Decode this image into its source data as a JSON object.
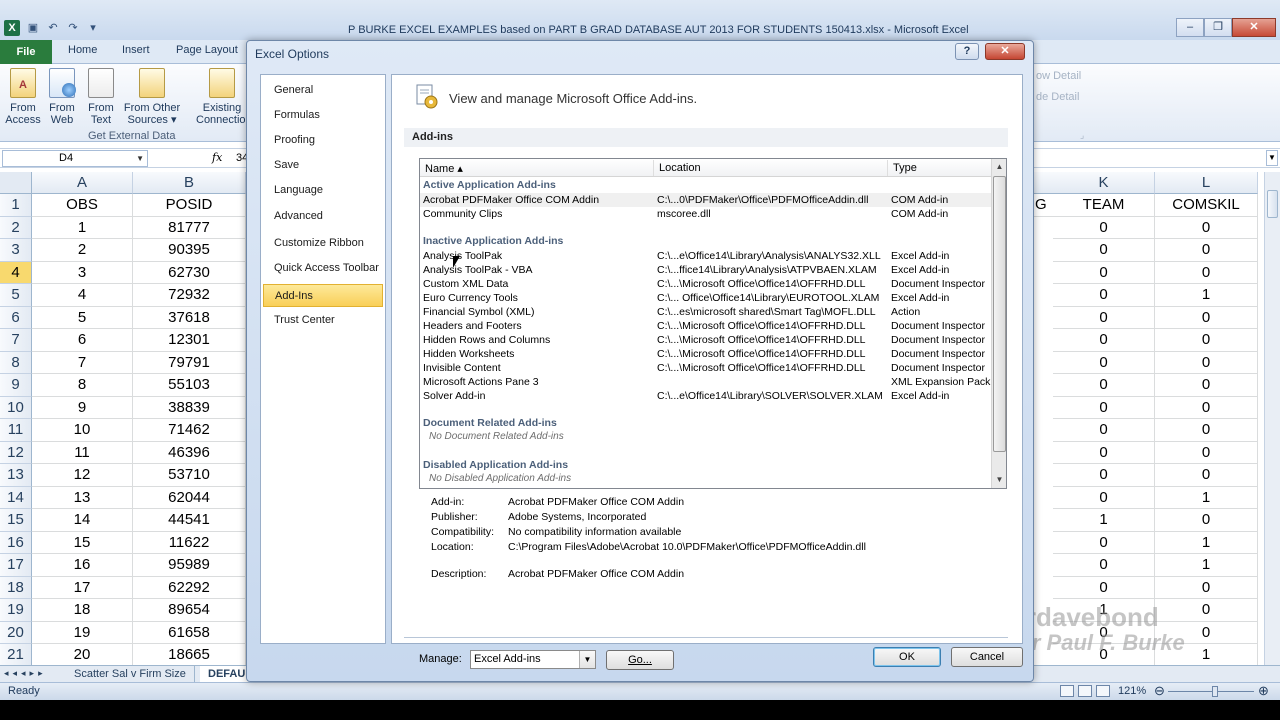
{
  "window": {
    "title": "P BURKE EXCEL EXAMPLES based on PART B GRAD DATABASE AUT 2013 FOR STUDENTS 150413.xlsx  -  Microsoft Excel"
  },
  "ribbon_tabs": [
    "File",
    "Home",
    "Insert",
    "Page Layout"
  ],
  "ribbon": {
    "buttons": [
      {
        "label1": "From",
        "label2": "Access"
      },
      {
        "label1": "From",
        "label2": "Web"
      },
      {
        "label1": "From",
        "label2": "Text"
      },
      {
        "label1": "From Other",
        "label2": "Sources ▾"
      },
      {
        "label1": "Existing",
        "label2": "Connection"
      }
    ],
    "group_label": "Get External Data",
    "right_items": [
      "ow Detail",
      "de Detail"
    ]
  },
  "formula_bar": {
    "name_box": "D4",
    "fx": "fx",
    "value": "34"
  },
  "grid": {
    "columns_left": [
      {
        "letter": "A",
        "header": "OBS"
      },
      {
        "letter": "B",
        "header": "POSID"
      }
    ],
    "columns_right": [
      {
        "letter": "K",
        "header": "TEAM"
      },
      {
        "letter": "L",
        "header": "COMSKIL"
      }
    ],
    "partial_right_header": "G",
    "selected_row": 4,
    "rows": [
      {
        "r": "2",
        "a": "1",
        "b": "81777",
        "k": "0",
        "l": "0"
      },
      {
        "r": "3",
        "a": "2",
        "b": "90395",
        "k": "0",
        "l": "0"
      },
      {
        "r": "4",
        "a": "3",
        "b": "62730",
        "k": "0",
        "l": "0"
      },
      {
        "r": "5",
        "a": "4",
        "b": "72932",
        "k": "0",
        "l": "1"
      },
      {
        "r": "6",
        "a": "5",
        "b": "37618",
        "k": "0",
        "l": "0"
      },
      {
        "r": "7",
        "a": "6",
        "b": "12301",
        "k": "0",
        "l": "0"
      },
      {
        "r": "8",
        "a": "7",
        "b": "79791",
        "k": "0",
        "l": "0"
      },
      {
        "r": "9",
        "a": "8",
        "b": "55103",
        "k": "0",
        "l": "0"
      },
      {
        "r": "10",
        "a": "9",
        "b": "38839",
        "k": "0",
        "l": "0"
      },
      {
        "r": "11",
        "a": "10",
        "b": "71462",
        "k": "0",
        "l": "0"
      },
      {
        "r": "12",
        "a": "11",
        "b": "46396",
        "k": "0",
        "l": "0"
      },
      {
        "r": "13",
        "a": "12",
        "b": "53710",
        "k": "0",
        "l": "0"
      },
      {
        "r": "14",
        "a": "13",
        "b": "62044",
        "k": "0",
        "l": "1"
      },
      {
        "r": "15",
        "a": "14",
        "b": "44541",
        "k": "1",
        "l": "0"
      },
      {
        "r": "16",
        "a": "15",
        "b": "11622",
        "k": "0",
        "l": "1"
      },
      {
        "r": "17",
        "a": "16",
        "b": "95989",
        "k": "0",
        "l": "1"
      },
      {
        "r": "18",
        "a": "17",
        "b": "62292",
        "k": "0",
        "l": "0"
      },
      {
        "r": "19",
        "a": "18",
        "b": "89654",
        "k": "1",
        "l": "0"
      },
      {
        "r": "20",
        "a": "19",
        "b": "61658",
        "k": "0",
        "l": "0"
      },
      {
        "r": "21",
        "a": "20",
        "b": "18665",
        "k": "0",
        "l": "1"
      }
    ]
  },
  "sheet_tabs": [
    "Scatter Sal v Firm Size",
    "DEFAU"
  ],
  "status": {
    "ready": "Ready",
    "zoom": "121%"
  },
  "watermark": [
    "drdavebond",
    "Dr Paul F. Burke"
  ],
  "dialog": {
    "title": "Excel Options",
    "help": "?",
    "nav": [
      "General",
      "Formulas",
      "Proofing",
      "Save",
      "Language",
      "Advanced",
      "Customize Ribbon",
      "Quick Access Toolbar",
      "Add-Ins",
      "Trust Center"
    ],
    "active_nav": "Add-Ins",
    "heading": "View and manage Microsoft Office Add-ins.",
    "section": "Add-ins",
    "columns": [
      "Name ▴",
      "Location",
      "Type"
    ],
    "groups": [
      {
        "title": "Active Application Add-ins",
        "items": [
          {
            "name": "Acrobat PDFMaker Office COM Addin",
            "location": "C:\\...0\\PDFMaker\\Office\\PDFMOfficeAddin.dll",
            "type": "COM Add-in",
            "selected": true
          },
          {
            "name": "Community Clips",
            "location": "mscoree.dll",
            "type": "COM Add-in"
          }
        ]
      },
      {
        "title": "Inactive Application Add-ins",
        "items": [
          {
            "name": "Analysis ToolPak",
            "location": "C:\\...e\\Office14\\Library\\Analysis\\ANALYS32.XLL",
            "type": "Excel Add-in"
          },
          {
            "name": "Analysis ToolPak - VBA",
            "location": "C:\\...ffice14\\Library\\Analysis\\ATPVBAEN.XLAM",
            "type": "Excel Add-in"
          },
          {
            "name": "Custom XML Data",
            "location": "C:\\...\\Microsoft Office\\Office14\\OFFRHD.DLL",
            "type": "Document Inspector"
          },
          {
            "name": "Euro Currency Tools",
            "location": "C:\\... Office\\Office14\\Library\\EUROTOOL.XLAM",
            "type": "Excel Add-in"
          },
          {
            "name": "Financial Symbol (XML)",
            "location": "C:\\...es\\microsoft shared\\Smart Tag\\MOFL.DLL",
            "type": "Action"
          },
          {
            "name": "Headers and Footers",
            "location": "C:\\...\\Microsoft Office\\Office14\\OFFRHD.DLL",
            "type": "Document Inspector"
          },
          {
            "name": "Hidden Rows and Columns",
            "location": "C:\\...\\Microsoft Office\\Office14\\OFFRHD.DLL",
            "type": "Document Inspector"
          },
          {
            "name": "Hidden Worksheets",
            "location": "C:\\...\\Microsoft Office\\Office14\\OFFRHD.DLL",
            "type": "Document Inspector"
          },
          {
            "name": "Invisible Content",
            "location": "C:\\...\\Microsoft Office\\Office14\\OFFRHD.DLL",
            "type": "Document Inspector"
          },
          {
            "name": "Microsoft Actions Pane 3",
            "location": "",
            "type": "XML Expansion Pack"
          },
          {
            "name": "Solver Add-in",
            "location": "C:\\...e\\Office14\\Library\\SOLVER\\SOLVER.XLAM",
            "type": "Excel Add-in"
          }
        ]
      },
      {
        "title": "Document Related Add-ins",
        "empty": "No Document Related Add-ins"
      },
      {
        "title": "Disabled Application Add-ins",
        "empty": "No Disabled Application Add-ins"
      }
    ],
    "details": [
      {
        "label": "Add-in:",
        "value": "Acrobat PDFMaker Office COM Addin"
      },
      {
        "label": "Publisher:",
        "value": "Adobe Systems, Incorporated"
      },
      {
        "label": "Compatibility:",
        "value": "No compatibility information available"
      },
      {
        "label": "Location:",
        "value": "C:\\Program Files\\Adobe\\Acrobat 10.0\\PDFMaker\\Office\\PDFMOfficeAddin.dll"
      },
      {
        "label": "Description:",
        "value": "Acrobat PDFMaker Office COM Addin"
      }
    ],
    "manage_label": "Manage:",
    "manage_value": "Excel Add-ins",
    "go_label": "Go...",
    "ok_label": "OK",
    "cancel_label": "Cancel"
  }
}
